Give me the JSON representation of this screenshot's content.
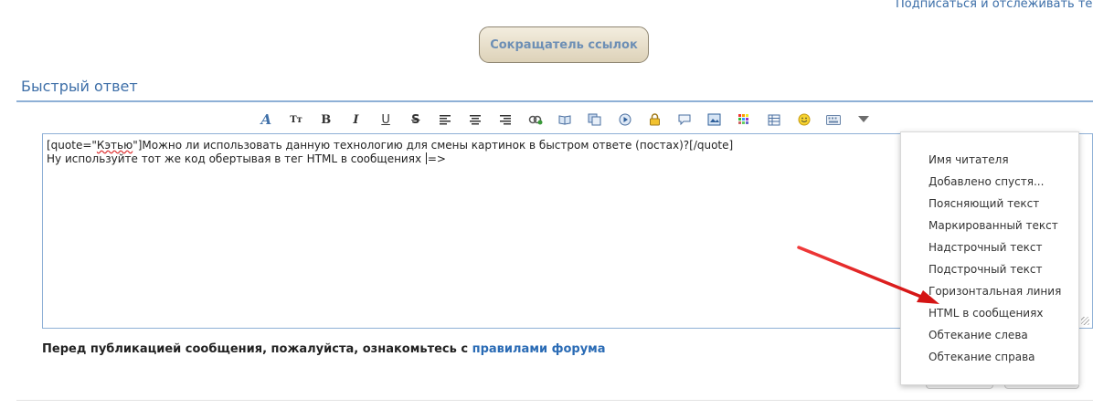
{
  "header": {
    "subscribe_link": "Подписаться и отслеживать тему",
    "shortener_button": "Сокращатель ссылок"
  },
  "quick_reply": {
    "title": "Быстрый ответ"
  },
  "toolbar": {
    "buttons": [
      {
        "icon": "font-style-icon",
        "label": "A"
      },
      {
        "icon": "font-size-icon",
        "label": "Tт"
      },
      {
        "icon": "bold-icon",
        "label": "B"
      },
      {
        "icon": "italic-icon",
        "label": "I"
      },
      {
        "icon": "underline-icon",
        "label": "U"
      },
      {
        "icon": "strikethrough-icon",
        "label": "S"
      },
      {
        "icon": "align-left-icon"
      },
      {
        "icon": "align-center-icon"
      },
      {
        "icon": "align-right-icon"
      },
      {
        "icon": "link-icon"
      },
      {
        "icon": "book-icon"
      },
      {
        "icon": "copy-icon"
      },
      {
        "icon": "play-icon"
      },
      {
        "icon": "lock-icon"
      },
      {
        "icon": "speech-bubble-icon"
      },
      {
        "icon": "image-icon"
      },
      {
        "icon": "color-grid-icon"
      },
      {
        "icon": "table-icon"
      },
      {
        "icon": "smiley-icon"
      },
      {
        "icon": "keyboard-icon"
      },
      {
        "icon": "dropdown-triangle-icon"
      }
    ]
  },
  "editor": {
    "line1_prefix": "[quote=\"",
    "line1_name": "Кэтью",
    "line1_rest": "\"]Можно ли использовать данную технологию для смены картинок в быстром ответе (постах)?[/quote]",
    "line2_before_caret": "Ну используйте тот же код обертывая в тег HTML в сообщениях ",
    "line2_after_caret": "=>"
  },
  "rules_notice": {
    "text": "Перед публикацией сообщения, пожалуйста, ознакомьтесь с ",
    "link": "правилами форума"
  },
  "dropdown": {
    "items": [
      "Имя читателя",
      "Добавлено спустя...",
      "Поясняющий текст",
      "Маркированный текст",
      "Надстрочный текст",
      "Подстрочный текст",
      "Горизонтальная линия",
      "HTML в сообщениях",
      "Обтекание слева",
      "Обтекание справа"
    ]
  },
  "colors": {
    "accent_blue": "#3e6fa8",
    "arrow_red": "#e02020",
    "button_beige": "#e6dcc6"
  }
}
